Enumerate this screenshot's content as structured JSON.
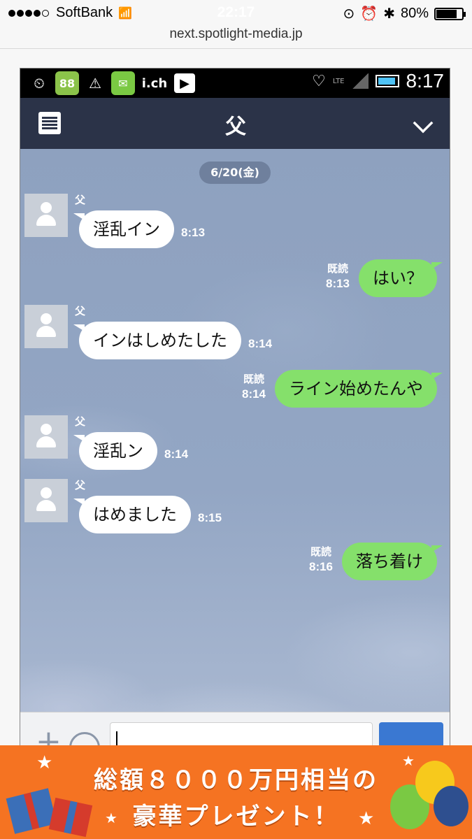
{
  "ios_status": {
    "carrier": "SoftBank",
    "time": "22:17",
    "battery": "80%",
    "battery_level": 0.8
  },
  "browser": {
    "url": "next.spotlight-media.jp"
  },
  "android_status": {
    "notif_number": "88",
    "ich_label": "i.ch",
    "lte": "LTE",
    "time": "8:17"
  },
  "chat": {
    "title": "父",
    "date": "6/20(金)",
    "read_label": "既読",
    "messages": [
      {
        "dir": "in",
        "sender": "父",
        "text": "淫乱イン",
        "time": "8:13"
      },
      {
        "dir": "out",
        "text": "はい？",
        "time": "8:13"
      },
      {
        "dir": "in",
        "sender": "父",
        "text": "インはしめたした",
        "time": "8:14"
      },
      {
        "dir": "out",
        "text": "ライン始めたんや",
        "time": "8:14"
      },
      {
        "dir": "in",
        "sender": "父",
        "text": "淫乱ン",
        "time": "8:14"
      },
      {
        "dir": "in",
        "sender": "父",
        "text": "はめました",
        "time": "8:15"
      },
      {
        "dir": "out",
        "text": "落ち着け",
        "time": "8:16"
      }
    ]
  },
  "input": {
    "plus_glyph": "+"
  },
  "banner": {
    "line1": "総額８０００万円相当の",
    "line2": "豪華プレゼント！"
  },
  "colors": {
    "header": "#2b3348",
    "bubble_out": "#85e06b",
    "banner": "#f57322",
    "send": "#3a78d2"
  }
}
